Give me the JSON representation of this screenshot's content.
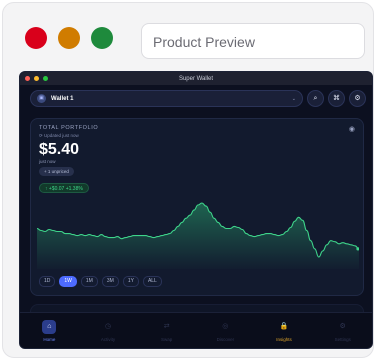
{
  "preview": {
    "title": "Product Preview",
    "dot_colors": [
      "#d9001b",
      "#d07c00",
      "#1e8a3c"
    ]
  },
  "window": {
    "title": "Super Wallet"
  },
  "header": {
    "wallet_name": "Wallet 1",
    "buttons": [
      {
        "icon": "search-icon"
      },
      {
        "icon": "expand-icon"
      },
      {
        "icon": "sliders-icon"
      }
    ]
  },
  "portfolio": {
    "label": "TOTAL PORTFOLIO",
    "updated": "⟳ Updated just now",
    "value": "$5.40",
    "sub": "just now",
    "unpriced": "+ 1 unpriced",
    "change": "↑ +$0.07 +1.38%",
    "change_color": "#3ed48a"
  },
  "chart_data": {
    "type": "area",
    "series": [
      {
        "values": [
          60,
          58,
          57,
          59,
          58,
          57,
          57,
          55,
          55,
          54,
          53,
          54,
          53,
          54,
          53,
          52,
          54,
          52,
          51,
          51,
          52,
          50,
          51,
          52,
          53,
          53,
          53,
          53,
          52,
          51,
          52,
          53,
          54,
          55,
          58,
          62,
          66,
          70,
          73,
          78,
          83,
          85,
          82,
          76,
          70,
          66,
          62,
          60,
          60,
          62,
          61,
          59,
          55,
          53,
          52,
          53,
          54,
          55,
          55,
          54,
          53,
          54,
          57,
          61,
          67,
          71,
          68,
          58,
          48,
          40,
          32,
          38,
          44,
          48,
          47,
          45,
          46,
          45,
          44,
          43,
          40
        ]
      }
    ],
    "color": "#3ed48a"
  },
  "ranges": {
    "options": [
      "1D",
      "1W",
      "1M",
      "3M",
      "1Y",
      "ALL"
    ],
    "selected": "1W"
  },
  "nav": {
    "items": [
      {
        "label": "Home",
        "icon": "home-icon"
      },
      {
        "label": "Activity",
        "icon": "clock-icon"
      },
      {
        "label": "Swap",
        "icon": "swap-icon"
      },
      {
        "label": "Discover",
        "icon": "compass-icon"
      },
      {
        "label": "Insights",
        "icon": "lock-icon"
      },
      {
        "label": "Settings",
        "icon": "gear-icon"
      }
    ],
    "active": "Home"
  }
}
